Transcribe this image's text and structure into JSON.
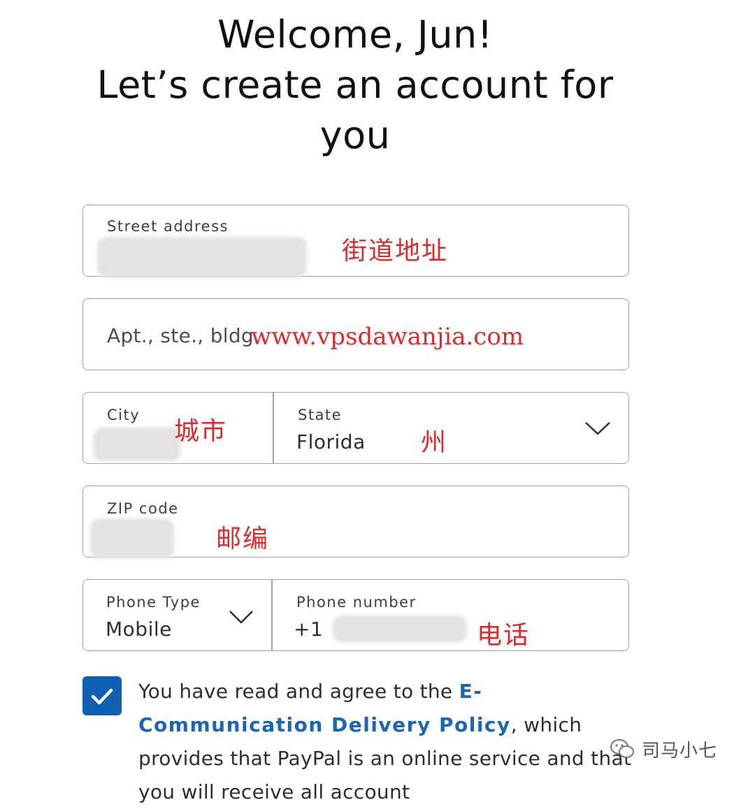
{
  "header": {
    "line1": "Welcome, Jun!",
    "line2": "Let’s create an account for",
    "line3": "you"
  },
  "form": {
    "street": {
      "label": "Street address",
      "annotation": "街道地址"
    },
    "apt": {
      "placeholder": "Apt., ste., bldg",
      "watermark": "www.vpsdawanjia.com"
    },
    "city": {
      "label": "City",
      "annotation": "城市"
    },
    "state": {
      "label": "State",
      "value": "Florida",
      "annotation": "州"
    },
    "zip": {
      "label": "ZIP code",
      "annotation": "邮编"
    },
    "phone_type": {
      "label": "Phone Type",
      "value": "Mobile"
    },
    "phone_number": {
      "label": "Phone number",
      "prefix": "+1",
      "annotation": "电话"
    }
  },
  "consent": {
    "checked": true,
    "text_before": "You have read and agree to the ",
    "link_text": "E-Communication Delivery Policy",
    "text_after": ", which provides that PayPal is an online service and that you will receive all account"
  },
  "watermark": {
    "account": "司马小七"
  },
  "colors": {
    "link": "#1b64b8",
    "checkbox": "#0f5fb3",
    "annotation": "#e02a2a",
    "border": "#9da3a6"
  }
}
